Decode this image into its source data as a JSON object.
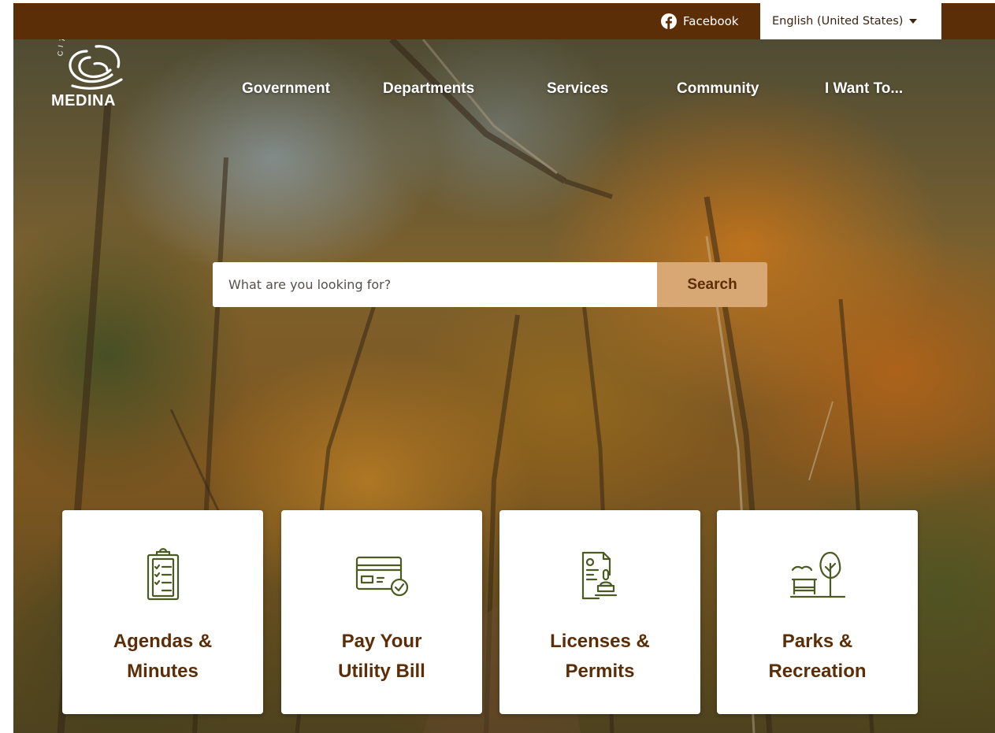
{
  "topbar": {
    "facebook_label": "Facebook",
    "language_label": "English (United States)"
  },
  "logo": {
    "arc_text": "CITY OF",
    "name": "MEDINA"
  },
  "nav": {
    "items": [
      {
        "label": "Government"
      },
      {
        "label": "Departments"
      },
      {
        "label": "Services"
      },
      {
        "label": "Community"
      },
      {
        "label": "I Want To..."
      }
    ]
  },
  "search": {
    "placeholder": "What are you looking for?",
    "button_label": "Search"
  },
  "quick_links": [
    {
      "label": "Agendas &\nMinutes",
      "icon": "clipboard-checklist-icon"
    },
    {
      "label": "Pay Your\nUtility Bill",
      "icon": "credit-card-check-icon"
    },
    {
      "label": "Licenses &\nPermits",
      "icon": "document-stamp-icon"
    },
    {
      "label": "Parks &\nRecreation",
      "icon": "park-bench-tree-icon"
    }
  ],
  "colors": {
    "brand_brown": "#5b2e08",
    "search_button": "#d7a774",
    "icon_green": "#4a5a22"
  }
}
